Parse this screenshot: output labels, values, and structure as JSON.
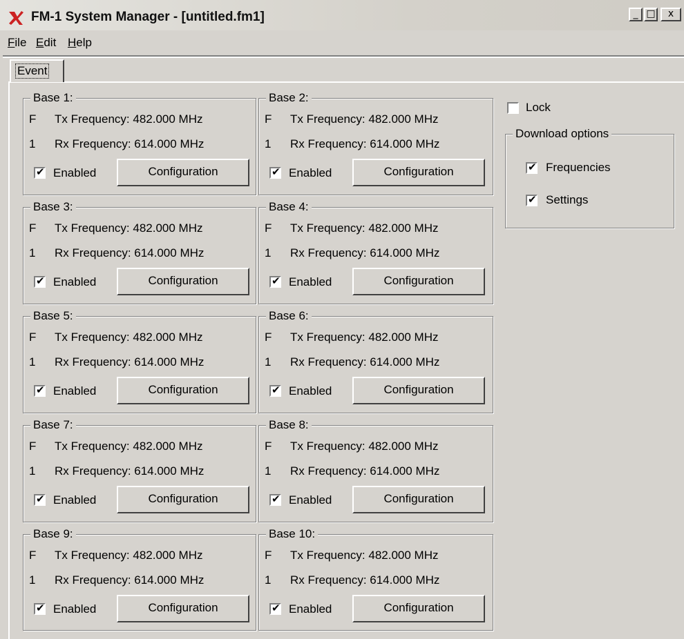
{
  "window": {
    "title": "FM-1 System Manager - [untitled.fm1]",
    "controls": {
      "minimize": "_",
      "maximize": "□",
      "close": "x"
    }
  },
  "menu": {
    "items": [
      {
        "accel": "F",
        "rest": "ile"
      },
      {
        "accel": "E",
        "rest": "dit"
      },
      {
        "accel": "H",
        "rest": "elp"
      }
    ]
  },
  "tabs": [
    {
      "label": "Event"
    }
  ],
  "bases": [
    {
      "legend": "Base 1:",
      "row1_prefix": "F",
      "tx": "Tx Frequency: 482.000 MHz",
      "row2_prefix": "1",
      "rx": "Rx Frequency: 614.000 MHz",
      "enabled": true,
      "enabled_label": "Enabled",
      "config_label": "Configuration"
    },
    {
      "legend": "Base 2:",
      "row1_prefix": "F",
      "tx": "Tx Frequency: 482.000 MHz",
      "row2_prefix": "1",
      "rx": "Rx Frequency: 614.000 MHz",
      "enabled": true,
      "enabled_label": "Enabled",
      "config_label": "Configuration"
    },
    {
      "legend": "Base 3:",
      "row1_prefix": "F",
      "tx": "Tx Frequency: 482.000 MHz",
      "row2_prefix": "1",
      "rx": "Rx Frequency: 614.000 MHz",
      "enabled": true,
      "enabled_label": "Enabled",
      "config_label": "Configuration"
    },
    {
      "legend": "Base 4:",
      "row1_prefix": "F",
      "tx": "Tx Frequency: 482.000 MHz",
      "row2_prefix": "1",
      "rx": "Rx Frequency: 614.000 MHz",
      "enabled": true,
      "enabled_label": "Enabled",
      "config_label": "Configuration"
    },
    {
      "legend": "Base 5:",
      "row1_prefix": "F",
      "tx": "Tx Frequency: 482.000 MHz",
      "row2_prefix": "1",
      "rx": "Rx Frequency: 614.000 MHz",
      "enabled": true,
      "enabled_label": "Enabled",
      "config_label": "Configuration"
    },
    {
      "legend": "Base 6:",
      "row1_prefix": "F",
      "tx": "Tx Frequency: 482.000 MHz",
      "row2_prefix": "1",
      "rx": "Rx Frequency: 614.000 MHz",
      "enabled": true,
      "enabled_label": "Enabled",
      "config_label": "Configuration"
    },
    {
      "legend": "Base 7:",
      "row1_prefix": "F",
      "tx": "Tx Frequency: 482.000 MHz",
      "row2_prefix": "1",
      "rx": "Rx Frequency: 614.000 MHz",
      "enabled": true,
      "enabled_label": "Enabled",
      "config_label": "Configuration"
    },
    {
      "legend": "Base 8:",
      "row1_prefix": "F",
      "tx": "Tx Frequency: 482.000 MHz",
      "row2_prefix": "1",
      "rx": "Rx Frequency: 614.000 MHz",
      "enabled": true,
      "enabled_label": "Enabled",
      "config_label": "Configuration"
    },
    {
      "legend": "Base 9:",
      "row1_prefix": "F",
      "tx": "Tx Frequency: 482.000 MHz",
      "row2_prefix": "1",
      "rx": "Rx Frequency: 614.000 MHz",
      "enabled": true,
      "enabled_label": "Enabled",
      "config_label": "Configuration"
    },
    {
      "legend": "Base 10:",
      "row1_prefix": "F",
      "tx": "Tx Frequency: 482.000 MHz",
      "row2_prefix": "1",
      "rx": "Rx Frequency: 614.000 MHz",
      "enabled": true,
      "enabled_label": "Enabled",
      "config_label": "Configuration"
    }
  ],
  "lock": {
    "label": "Lock",
    "checked": false
  },
  "download": {
    "legend": "Download options",
    "frequencies": {
      "label": "Frequencies",
      "checked": true
    },
    "settings": {
      "label": "Settings",
      "checked": true
    }
  },
  "check_glyph": "✔",
  "colors": {
    "face": "#d6d3ce",
    "shadow": "#808080",
    "highlight": "#ffffff",
    "logo": "#cc2222"
  }
}
